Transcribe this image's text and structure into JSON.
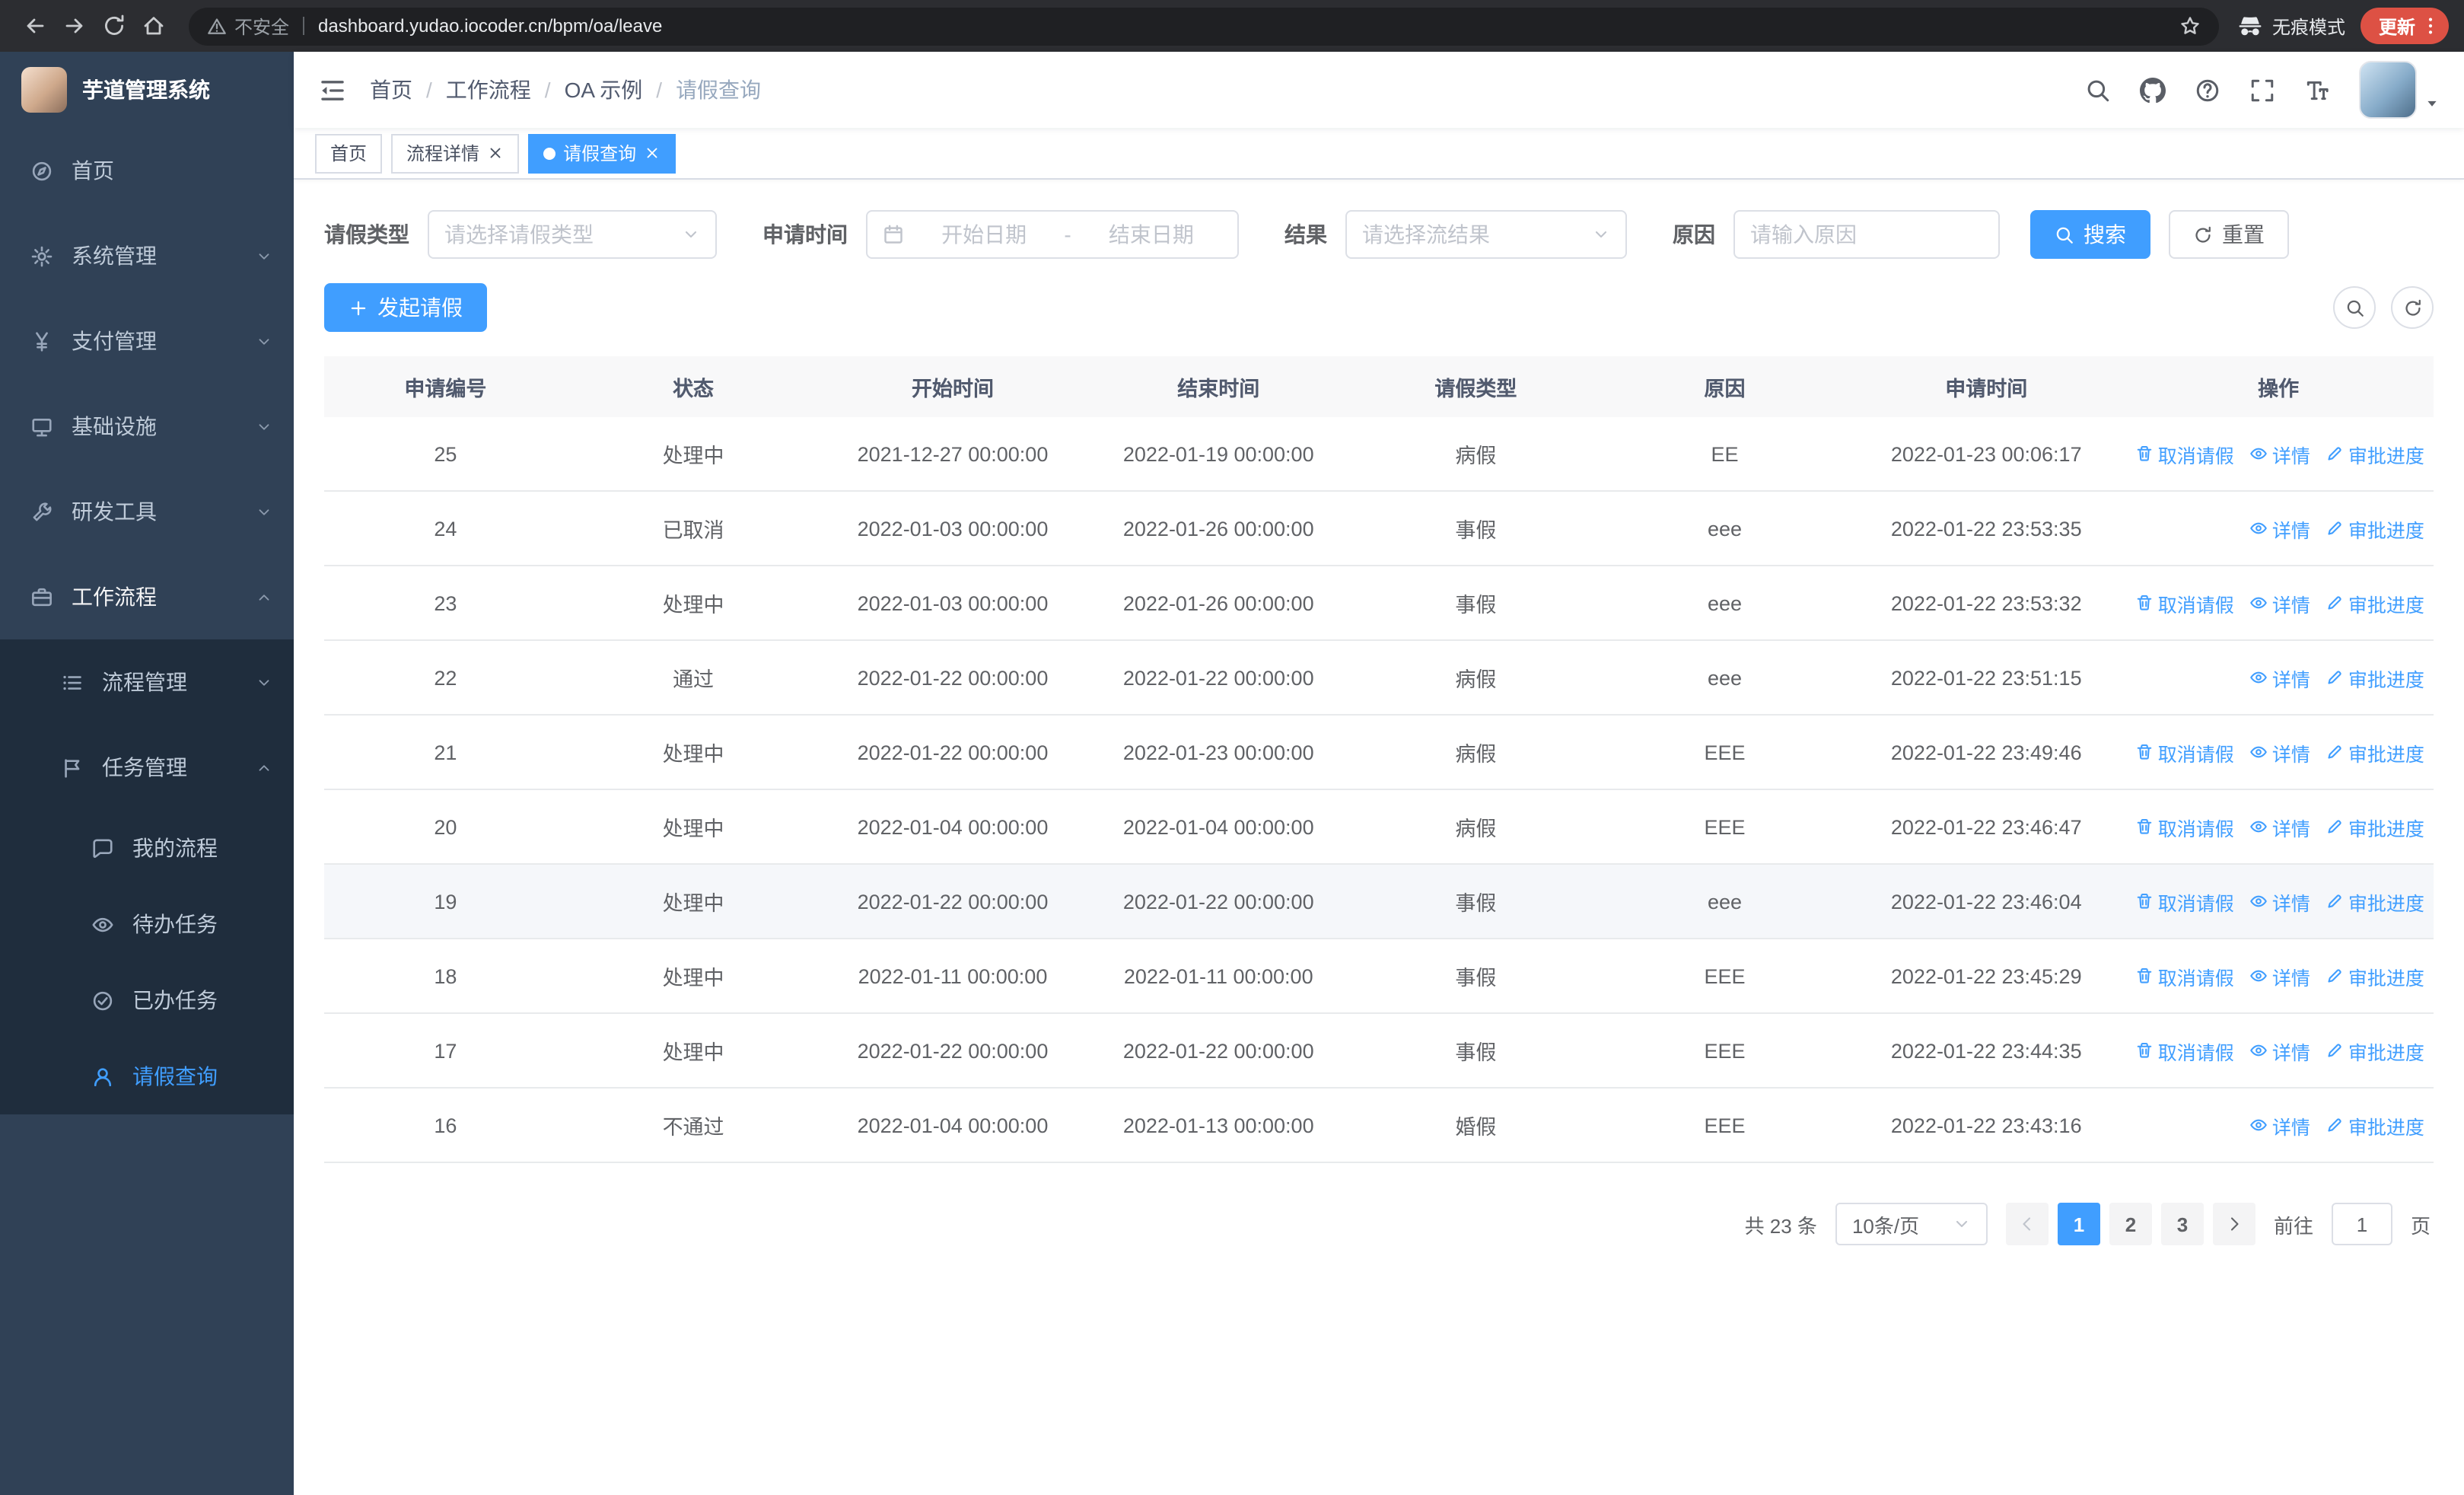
{
  "browser": {
    "security_warning": "不安全",
    "url": "dashboard.yudao.iocoder.cn/bpm/oa/leave",
    "incognito_label": "无痕模式",
    "update_label": "更新"
  },
  "sidebar": {
    "logo_title": "芋道管理系统",
    "items": [
      {
        "key": "home",
        "label": "首页",
        "icon": "guide",
        "level": 1,
        "expandable": false
      },
      {
        "key": "system",
        "label": "系统管理",
        "icon": "gear",
        "level": 1,
        "expandable": true,
        "expanded": false
      },
      {
        "key": "payment",
        "label": "支付管理",
        "icon": "yen",
        "level": 1,
        "expandable": true,
        "expanded": false
      },
      {
        "key": "infrastructure",
        "label": "基础设施",
        "icon": "infra",
        "level": 1,
        "expandable": true,
        "expanded": false
      },
      {
        "key": "devtools",
        "label": "研发工具",
        "icon": "tools",
        "level": 1,
        "expandable": true,
        "expanded": false
      },
      {
        "key": "workflow",
        "label": "工作流程",
        "icon": "workflow",
        "level": 1,
        "expandable": true,
        "expanded": true,
        "parent_open": true
      },
      {
        "key": "process-mgmt",
        "label": "流程管理",
        "icon": "process",
        "level": 2,
        "expandable": true,
        "expanded": false
      },
      {
        "key": "task-mgmt",
        "label": "任务管理",
        "icon": "task",
        "level": 2,
        "expandable": true,
        "expanded": true
      },
      {
        "key": "my-process",
        "label": "我的流程",
        "icon": "my-process",
        "level": 3
      },
      {
        "key": "todo-tasks",
        "label": "待办任务",
        "icon": "todo",
        "level": 3
      },
      {
        "key": "done-tasks",
        "label": "已办任务",
        "icon": "done",
        "level": 3
      },
      {
        "key": "leave-query",
        "label": "请假查询",
        "icon": "leave",
        "level": 3,
        "active": true
      }
    ]
  },
  "header": {
    "breadcrumb": [
      "首页",
      "工作流程",
      "OA 示例",
      "请假查询"
    ]
  },
  "tabs": [
    {
      "label": "首页",
      "closable": false,
      "active": false
    },
    {
      "label": "流程详情",
      "closable": true,
      "active": false
    },
    {
      "label": "请假查询",
      "closable": true,
      "active": true
    }
  ],
  "filters": {
    "leave_type_label": "请假类型",
    "leave_type_placeholder": "请选择请假类型",
    "apply_time_label": "申请时间",
    "start_date_placeholder": "开始日期",
    "range_separator": "-",
    "end_date_placeholder": "结束日期",
    "result_label": "结果",
    "result_placeholder": "请选择流结果",
    "reason_label": "原因",
    "reason_placeholder": "请输入原因",
    "search_button": "搜索",
    "reset_button": "重置"
  },
  "toolbar": {
    "create_button": "发起请假"
  },
  "table": {
    "columns": [
      "申请编号",
      "状态",
      "开始时间",
      "结束时间",
      "请假类型",
      "原因",
      "申请时间",
      "操作"
    ],
    "actions": {
      "cancel": {
        "label": "取消请假",
        "icon": "trash"
      },
      "detail": {
        "label": "详情",
        "icon": "eye"
      },
      "progress": {
        "label": "审批进度",
        "icon": "edit"
      }
    },
    "rows": [
      {
        "id": "25",
        "status": "处理中",
        "start": "2021-12-27 00:00:00",
        "end": "2022-01-19 00:00:00",
        "type": "病假",
        "reason": "EE",
        "apply_time": "2022-01-23 00:06:17",
        "actions": [
          "cancel",
          "detail",
          "progress"
        ],
        "highlight": false
      },
      {
        "id": "24",
        "status": "已取消",
        "start": "2022-01-03 00:00:00",
        "end": "2022-01-26 00:00:00",
        "type": "事假",
        "reason": "eee",
        "apply_time": "2022-01-22 23:53:35",
        "actions": [
          "detail",
          "progress"
        ],
        "highlight": false
      },
      {
        "id": "23",
        "status": "处理中",
        "start": "2022-01-03 00:00:00",
        "end": "2022-01-26 00:00:00",
        "type": "事假",
        "reason": "eee",
        "apply_time": "2022-01-22 23:53:32",
        "actions": [
          "cancel",
          "detail",
          "progress"
        ],
        "highlight": false
      },
      {
        "id": "22",
        "status": "通过",
        "start": "2022-01-22 00:00:00",
        "end": "2022-01-22 00:00:00",
        "type": "病假",
        "reason": "eee",
        "apply_time": "2022-01-22 23:51:15",
        "actions": [
          "detail",
          "progress"
        ],
        "highlight": false
      },
      {
        "id": "21",
        "status": "处理中",
        "start": "2022-01-22 00:00:00",
        "end": "2022-01-23 00:00:00",
        "type": "病假",
        "reason": "EEE",
        "apply_time": "2022-01-22 23:49:46",
        "actions": [
          "cancel",
          "detail",
          "progress"
        ],
        "highlight": false
      },
      {
        "id": "20",
        "status": "处理中",
        "start": "2022-01-04 00:00:00",
        "end": "2022-01-04 00:00:00",
        "type": "病假",
        "reason": "EEE",
        "apply_time": "2022-01-22 23:46:47",
        "actions": [
          "cancel",
          "detail",
          "progress"
        ],
        "highlight": false
      },
      {
        "id": "19",
        "status": "处理中",
        "start": "2022-01-22 00:00:00",
        "end": "2022-01-22 00:00:00",
        "type": "事假",
        "reason": "eee",
        "apply_time": "2022-01-22 23:46:04",
        "actions": [
          "cancel",
          "detail",
          "progress"
        ],
        "highlight": true
      },
      {
        "id": "18",
        "status": "处理中",
        "start": "2022-01-11 00:00:00",
        "end": "2022-01-11 00:00:00",
        "type": "事假",
        "reason": "EEE",
        "apply_time": "2022-01-22 23:45:29",
        "actions": [
          "cancel",
          "detail",
          "progress"
        ],
        "highlight": false
      },
      {
        "id": "17",
        "status": "处理中",
        "start": "2022-01-22 00:00:00",
        "end": "2022-01-22 00:00:00",
        "type": "事假",
        "reason": "EEE",
        "apply_time": "2022-01-22 23:44:35",
        "actions": [
          "cancel",
          "detail",
          "progress"
        ],
        "highlight": false
      },
      {
        "id": "16",
        "status": "不通过",
        "start": "2022-01-04 00:00:00",
        "end": "2022-01-13 00:00:00",
        "type": "婚假",
        "reason": "EEE",
        "apply_time": "2022-01-22 23:43:16",
        "actions": [
          "detail",
          "progress"
        ],
        "highlight": false
      }
    ]
  },
  "pagination": {
    "total_text": "共 23 条",
    "page_size": "10条/页",
    "pages": [
      "1",
      "2",
      "3"
    ],
    "active_page": "1",
    "goto_label": "前往",
    "goto_value": "1",
    "page_label": "页"
  },
  "colors": {
    "primary": "#409eff",
    "sidebar_bg": "#304156",
    "submenu_bg": "#1f2d3d",
    "update_pill": "#dd5144"
  }
}
